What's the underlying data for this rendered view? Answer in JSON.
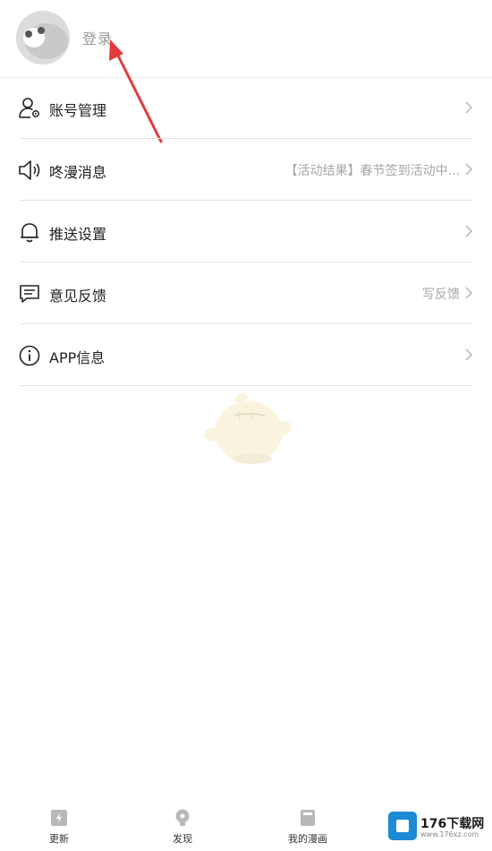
{
  "header": {
    "login_label": "登录",
    "avatar_icon": "mascot-avatar-icon",
    "accent_color": "#e23b3b"
  },
  "menu": {
    "items": [
      {
        "label": "账号管理",
        "icon": "account-settings-icon",
        "value": "",
        "chevron": true
      },
      {
        "label": "咚漫消息",
        "icon": "speaker-icon",
        "value": "【活动结果】春节签到活动中...",
        "chevron": true
      },
      {
        "label": "推送设置",
        "icon": "bell-icon",
        "value": "",
        "chevron": true
      },
      {
        "label": "意见反馈",
        "icon": "feedback-icon",
        "value": "写反馈",
        "chevron": true
      },
      {
        "label": "APP信息",
        "icon": "info-icon",
        "value": "",
        "chevron": true
      }
    ]
  },
  "tabbar": {
    "tabs": [
      {
        "label": "更新",
        "icon": "update-icon"
      },
      {
        "label": "发现",
        "icon": "discover-icon"
      },
      {
        "label": "我的漫画",
        "icon": "my-comics-icon"
      }
    ]
  },
  "watermark": {
    "brand_name": "176下载网",
    "brand_sub": "www.176xz.com"
  }
}
